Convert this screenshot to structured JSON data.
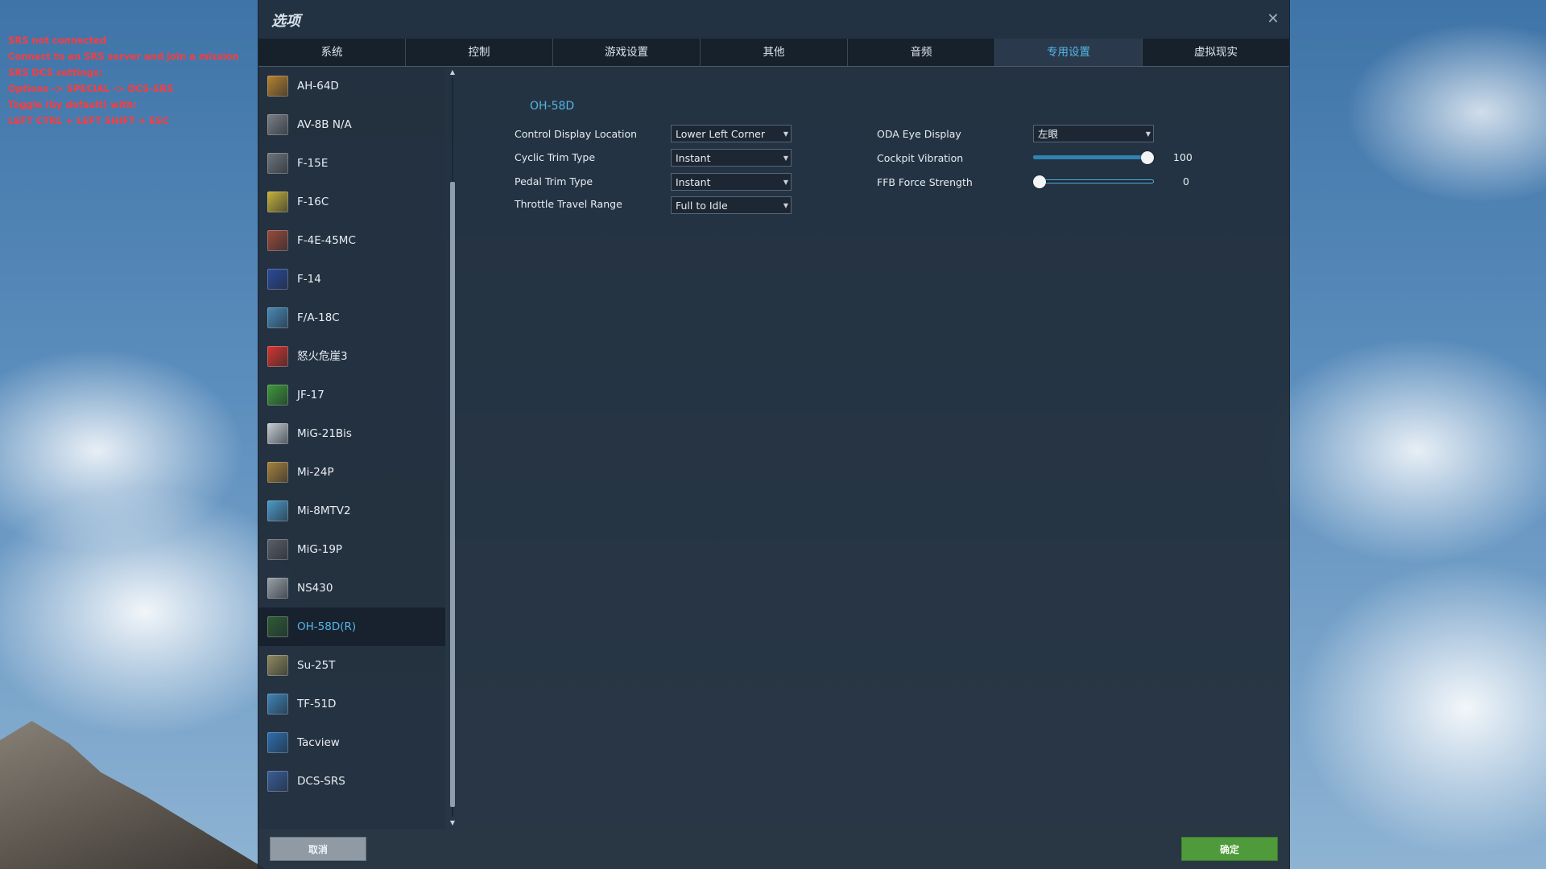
{
  "srs_overlay": {
    "lines": [
      "SRS not connected",
      "Connect to an SRS server and join a mission",
      "SRS DCS settings:",
      "Options -> SPECIAL -> DCS-SRS",
      "Toggle (by default) with:",
      "LEFT CTRL + LEFT SHIFT + ESC"
    ]
  },
  "dialog": {
    "title": "选项",
    "close_glyph": "✕"
  },
  "tabs": [
    {
      "label": "系统",
      "active": false
    },
    {
      "label": "控制",
      "active": false
    },
    {
      "label": "游戏设置",
      "active": false
    },
    {
      "label": "其他",
      "active": false
    },
    {
      "label": "音频",
      "active": false
    },
    {
      "label": "专用设置",
      "active": true
    },
    {
      "label": "虚拟现实",
      "active": false
    }
  ],
  "sidebar": {
    "items": [
      {
        "label": "AH-64D",
        "icon": "ah64d-icon",
        "color": "#b8832e"
      },
      {
        "label": "AV-8B N/A",
        "icon": "av8b-icon",
        "color": "#7b7f86"
      },
      {
        "label": "F-15E",
        "icon": "f15e-icon",
        "color": "#6f757d"
      },
      {
        "label": "F-16C",
        "icon": "f16c-icon",
        "color": "#c7b23a"
      },
      {
        "label": "F-4E-45MC",
        "icon": "f4e-icon",
        "color": "#9a4b3a"
      },
      {
        "label": "F-14",
        "icon": "f14-icon",
        "color": "#2c4a9a"
      },
      {
        "label": "F/A-18C",
        "icon": "fa18c-icon",
        "color": "#4a8ab8"
      },
      {
        "label": "怒火危崖3",
        "icon": "red-star-icon",
        "color": "#d6362f"
      },
      {
        "label": "JF-17",
        "icon": "jf17-icon",
        "color": "#3f9a3a"
      },
      {
        "label": "MiG-21Bis",
        "icon": "mig21-icon",
        "color": "#c8ced4"
      },
      {
        "label": "Mi-24P",
        "icon": "mi24p-icon",
        "color": "#a8823a"
      },
      {
        "label": "Mi-8MTV2",
        "icon": "mi8-icon",
        "color": "#4d9ac8"
      },
      {
        "label": "MiG-19P",
        "icon": "mig19-icon",
        "color": "#5b6068"
      },
      {
        "label": "NS430",
        "icon": "ns430-icon",
        "color": "#9aa1a8"
      },
      {
        "label": "OH-58D(R)",
        "icon": "oh58d-icon",
        "color": "#2f5c34",
        "selected": true
      },
      {
        "label": "Su-25T",
        "icon": "su25t-icon",
        "color": "#8f8a5e"
      },
      {
        "label": "TF-51D",
        "icon": "tf51d-icon",
        "color": "#3f85b8"
      },
      {
        "label": "Tacview",
        "icon": "tacview-icon",
        "color": "#2f6fb0"
      },
      {
        "label": "DCS-SRS",
        "icon": "dcs-srs-icon",
        "color": "#3a5e9a"
      }
    ]
  },
  "settings": {
    "module_title": "OH-58D",
    "left": [
      {
        "label": "Control Display Location",
        "value": "Lower Left Corner"
      },
      {
        "label": "Cyclic Trim Type",
        "value": "Instant"
      },
      {
        "label": "Pedal Trim Type",
        "value": "Instant"
      },
      {
        "label": "Throttle Travel Range",
        "value": "Full to Idle"
      }
    ],
    "oda_eye_display": {
      "label": "ODA Eye Display",
      "value": "左眼"
    },
    "cockpit_vibration": {
      "label": "Cockpit Vibration",
      "value": "100",
      "level": 1.0
    },
    "ffb_force_strength": {
      "label": "FFB Force Strength",
      "value": "0",
      "level": 0.0
    }
  },
  "footer": {
    "cancel_label": "取消",
    "ok_label": "确定"
  },
  "colors": {
    "accent": "#53b6e6",
    "ok_button": "#4f9a3a",
    "cancel_button": "#8f9aa5",
    "srs_warning": "#ff3b3b"
  }
}
